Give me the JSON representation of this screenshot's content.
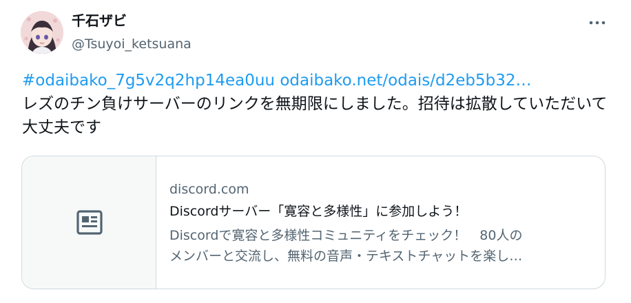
{
  "tweet": {
    "display_name": "千石ザビ",
    "handle": "@Tsuyoi_ketsuana",
    "hashtag": "#odaibako_7g5v2q2hp14ea0uu",
    "url": "odaibako.net/odais/d2eb5b32…",
    "body": "レズのチン負けサーバーのリンクを無期限にしました。招待は拡散していただいて大丈夫です",
    "more_icon": "more-horizontal-icon"
  },
  "card": {
    "domain": "discord.com",
    "title": "Discordサーバー「寛容と多様性」に参加しよう！",
    "description_line1": "Discordで寛容と多様性コミュニティをチェック！　80人の",
    "description_line2": "メンバーと交流し、無料の音声・テキストチャットを楽し…",
    "thumb_icon": "article-icon"
  },
  "colors": {
    "link": "#1d9bf0",
    "secondary_text": "#536471",
    "border": "#cfd9de"
  }
}
